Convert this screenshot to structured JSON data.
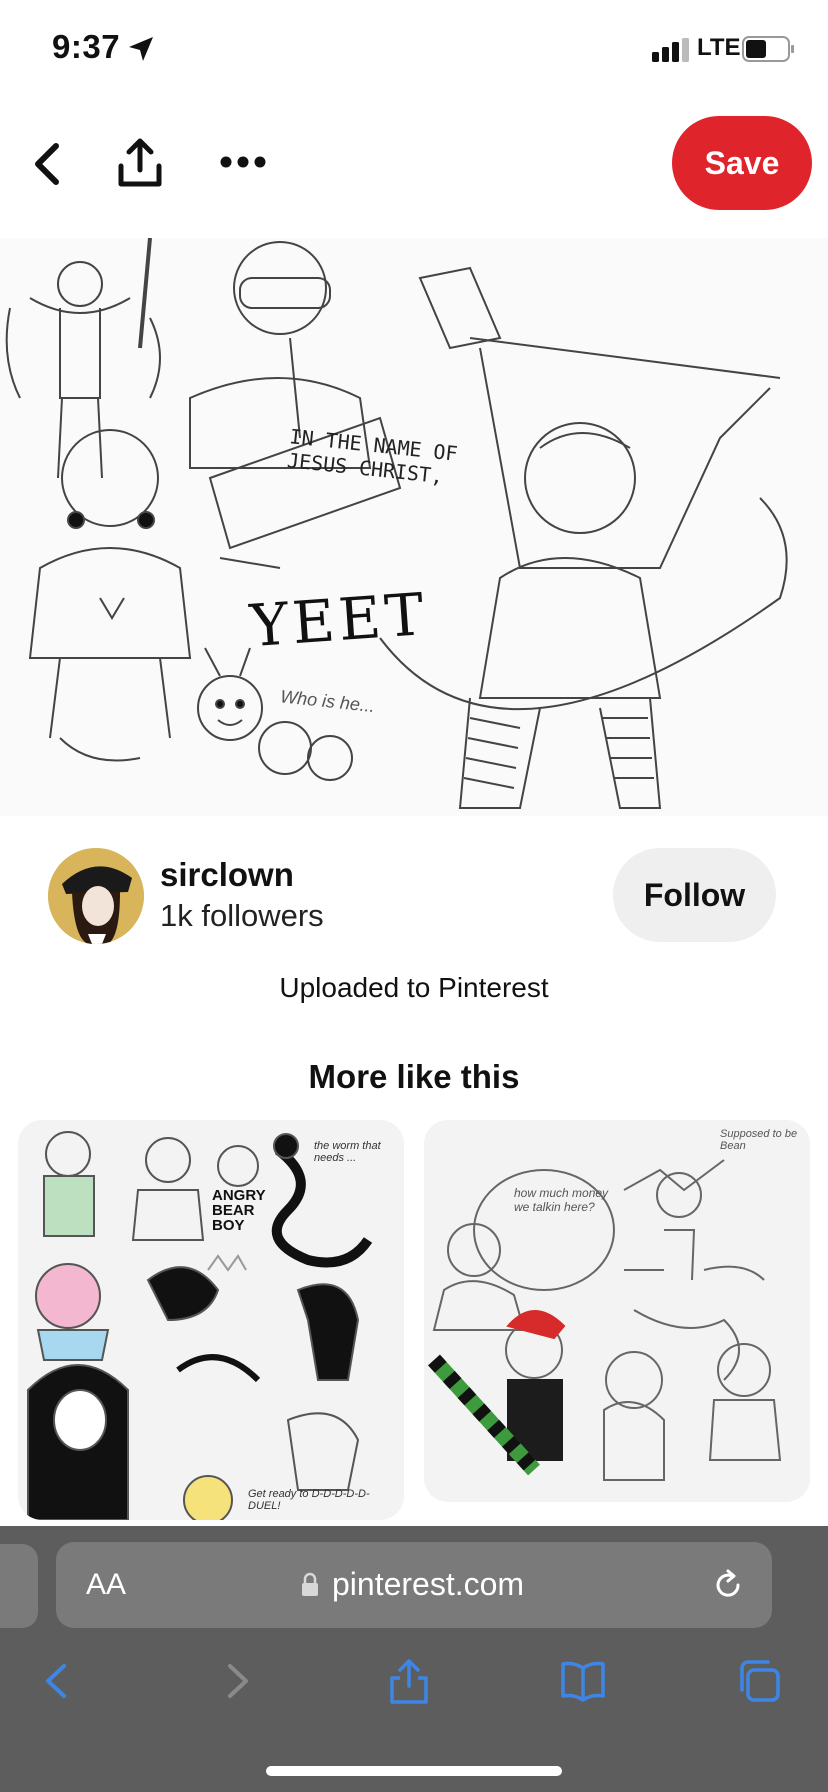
{
  "status_bar": {
    "time": "9:37",
    "network": "LTE"
  },
  "top_bar": {
    "save_label": "Save"
  },
  "creator": {
    "name": "sirclown",
    "followers": "1k followers",
    "follow_label": "Follow"
  },
  "pin": {
    "image_texts": [
      "IN THE NAME OF JESUS CHRIST,",
      "YEET",
      "Who is he..."
    ],
    "uploaded_text": "Uploaded to Pinterest"
  },
  "related": {
    "heading": "More like this",
    "cards": [
      {
        "texts": [
          "ANGRY BEAR BOY",
          "the worm that needs ...",
          "Get ready to D-D-D-D-D-DUEL!"
        ]
      },
      {
        "texts": [
          "how much money we talkin here?",
          "Supposed to be Bean"
        ]
      }
    ]
  },
  "browser": {
    "text_size_label": "AA",
    "url": "pinterest.com"
  },
  "colors": {
    "brand_red": "#e0242c",
    "link_blue": "#3e86e6",
    "toolbar_gray": "#5d5d5d"
  }
}
